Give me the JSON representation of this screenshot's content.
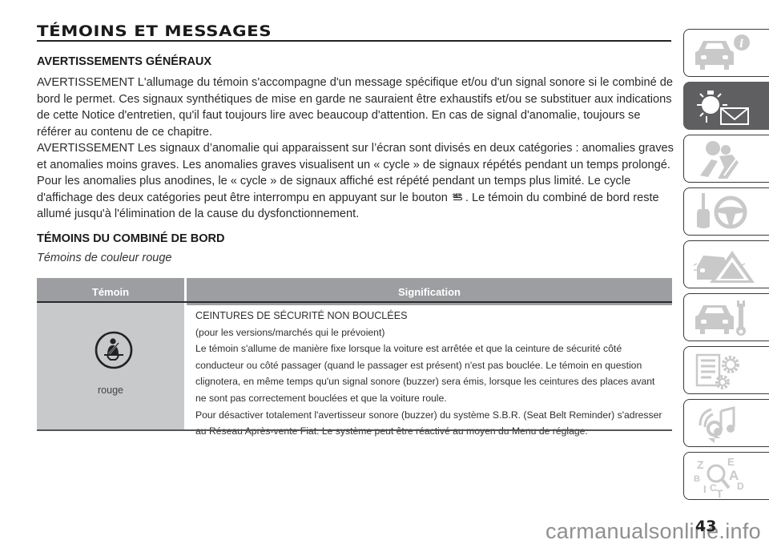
{
  "page": {
    "title": "TÉMOINS ET MESSAGES",
    "page_number": "43",
    "watermark": "carmanualsonline.info"
  },
  "section_general": {
    "heading": "AVERTISSEMENTS GÉNÉRAUX",
    "para1": "AVERTISSEMENT L'allumage du témoin s'accompagne d'un message spécifique et/ou d'un signal sonore si le combiné de bord le permet. Ces signaux synthétiques de mise en garde ne sauraient être exhaustifs et/ou se substituer aux indications de cette Notice d'entretien, qu'il faut toujours lire avec beaucoup d'attention. En cas de signal d'anomalie, toujours se référer au contenu de ce chapitre.",
    "para2_before_icon": "AVERTISSEMENT Les signaux d’anomalie qui apparaissent sur l’écran sont divisés en deux catégories : anomalies graves et anomalies moins graves. Les anomalies graves visualisent un « cycle » de signaux répétés pendant un temps prolongé. Pour les anomalies plus anodines, le « cycle » de signaux affiché est répété pendant un temps plus limité. Le cycle d'affichage des deux catégories peut être interrompu en appuyant sur le bouton",
    "set_icon_text": "SET",
    "para2_after_icon": ". Le témoin du combiné de bord reste allumé jusqu'à l'élimination de la cause du dysfonctionnement."
  },
  "section_cluster": {
    "heading": "TÉMOINS DU COMBINÉ DE BORD",
    "subheading": "Témoins de couleur rouge",
    "table": {
      "headers": [
        "Témoin",
        "Signification"
      ],
      "rows": [
        {
          "icon": "seatbelt-warning-icon",
          "color_label": "rouge",
          "lines": [
            "CEINTURES DE SÉCURITÉ NON BOUCLÉES",
            "(pour les versions/marchés qui le prévoient)",
            "Le témoin s'allume de manière fixe lorsque la voiture est arrêtée et que la ceinture de sécurité côté",
            "conducteur ou côté passager (quand le passager est présent) n'est pas bouclée. Le témoin en question",
            "clignotera, en même temps qu'un signal sonore (buzzer) sera émis, lorsque les ceintures des places avant",
            "ne sont pas correctement bouclées et que la voiture roule.",
            "Pour désactiver totalement l'avertisseur sonore (buzzer) du système S.B.R. (Seat Belt Reminder) s'adresser",
            "au Réseau Après-vente Fiat. Le système peut être réactivé au moyen du Menu de réglage."
          ]
        }
      ]
    }
  },
  "sidenav": {
    "tabs": [
      {
        "name": "car-info",
        "icon": "car-info-icon",
        "active": false
      },
      {
        "name": "warning-lights-messages",
        "icon": "warning-light-message-icon",
        "active": true
      },
      {
        "name": "safety",
        "icon": "airbag-seatbelt-icon",
        "active": false
      },
      {
        "name": "starting-driving",
        "icon": "key-steering-wheel-icon",
        "active": false
      },
      {
        "name": "emergency",
        "icon": "car-warning-triangle-icon",
        "active": false
      },
      {
        "name": "maintenance",
        "icon": "car-wrench-icon",
        "active": false
      },
      {
        "name": "technical-data",
        "icon": "list-gears-icon",
        "active": false
      },
      {
        "name": "multimedia",
        "icon": "signal-music-icon",
        "active": false
      },
      {
        "name": "index",
        "icon": "alphabet-search-icon",
        "active": false
      }
    ],
    "index_letters": [
      "Z",
      "E",
      "A",
      "B",
      "D",
      "I",
      "C",
      "T"
    ]
  },
  "colors": {
    "table_header": "#9d9ea2",
    "table_cell": "#c8c9cb",
    "active_tab": "#5f5f61",
    "icon_gray": "#c9c9c9"
  }
}
